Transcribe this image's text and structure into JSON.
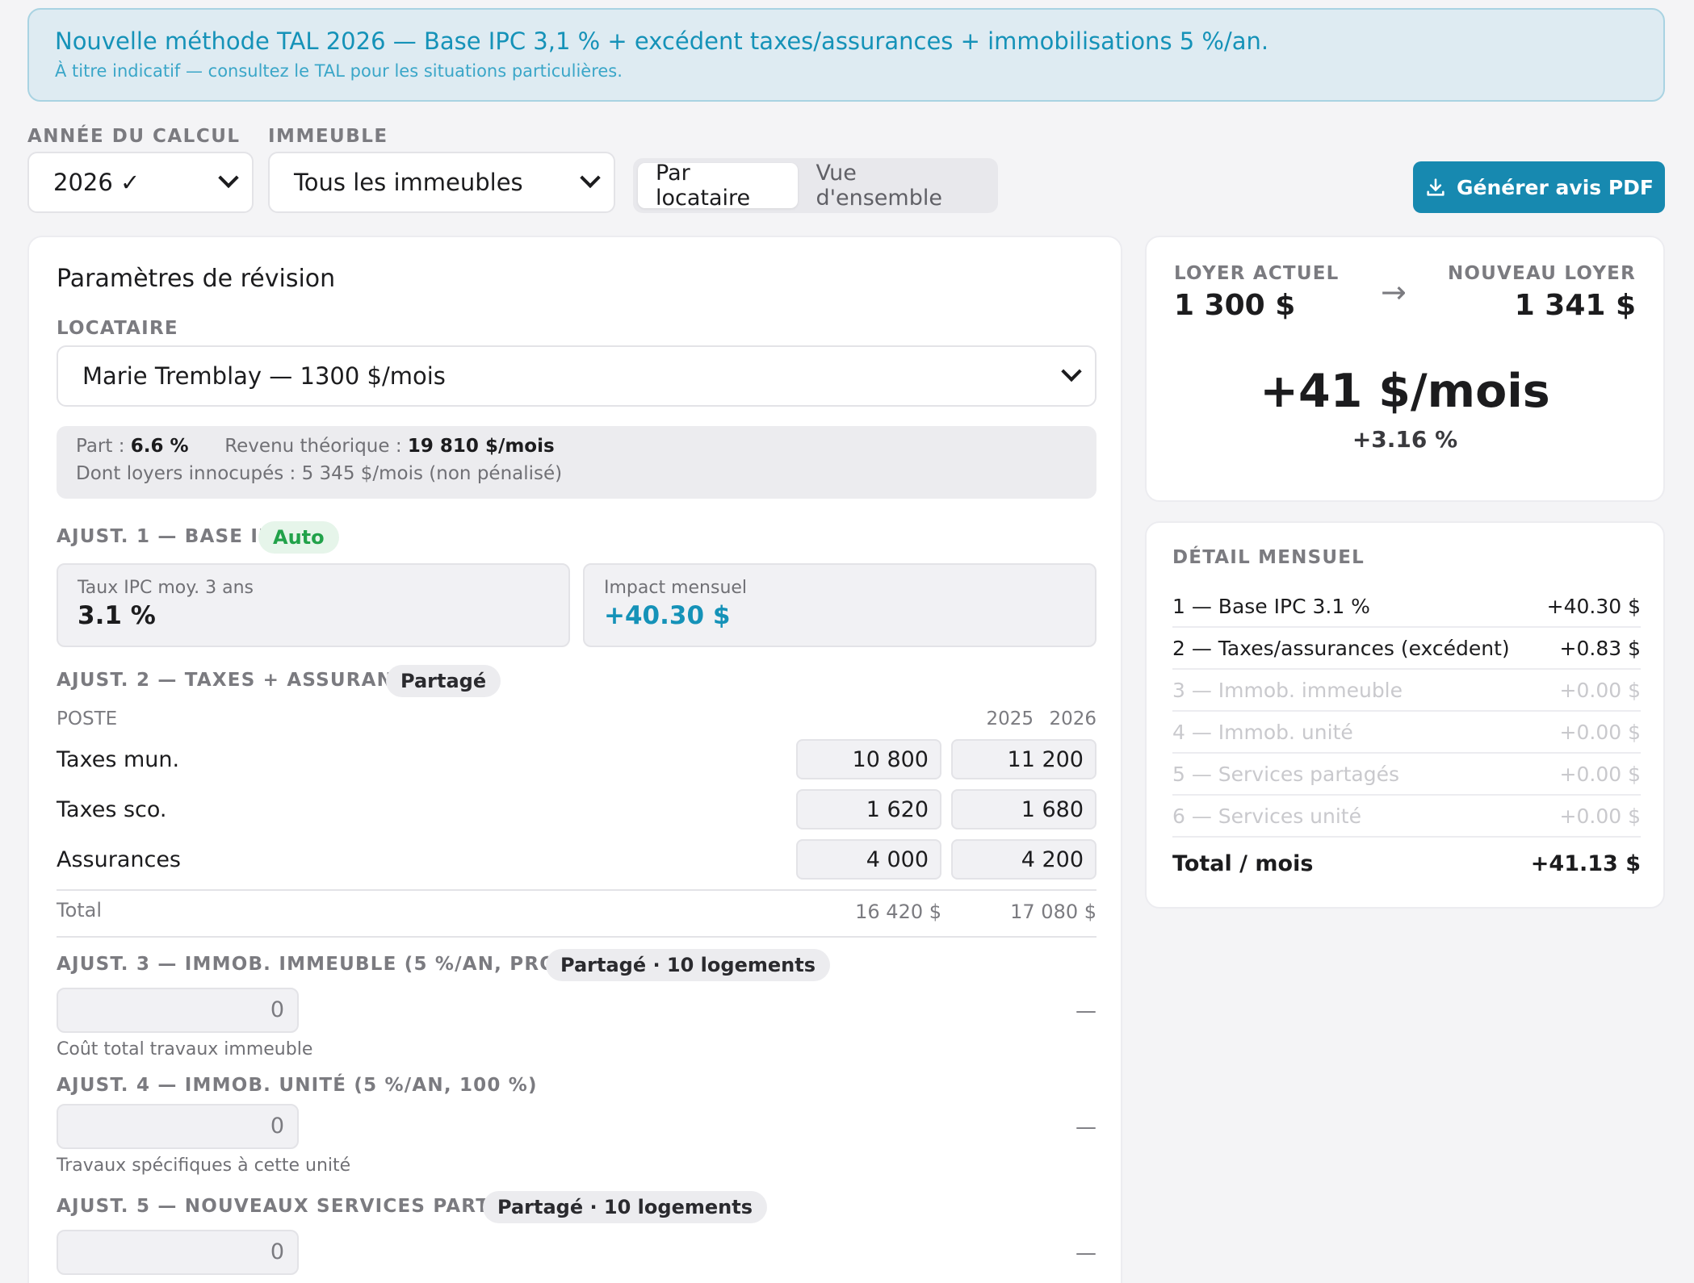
{
  "banner": {
    "title": "Nouvelle méthode TAL 2026 — Base IPC 3,1 % + excédent taxes/assurances + immobilisations 5 %/an.",
    "subtitle": "À titre indicatif — consultez le TAL pour les situations particulières."
  },
  "filters": {
    "year_label": "ANNÉE DU CALCUL",
    "year_value": "2026 ✓",
    "building_label": "IMMEUBLE",
    "building_value": "Tous les immeubles",
    "view_tabs": [
      "Par locataire",
      "Vue d'ensemble"
    ],
    "active_tab": "Par locataire",
    "pdf_button": "Générer avis PDF"
  },
  "params": {
    "title": "Paramètres de révision",
    "tenant_label": "LOCATAIRE",
    "tenant_value": "Marie Tremblay — 1300 $/mois",
    "share_label": "Part :",
    "share_value": "6.6 %",
    "revenue_label": "Revenu théorique :",
    "revenue_value": "19 810 $/mois",
    "vacant_note": "Dont loyers innocupés : 5 345 $/mois (non pénalisé)"
  },
  "adj1": {
    "label": "AJUST. 1 — BASE IPC",
    "badge": "Auto",
    "rate_label": "Taux IPC moy. 3 ans",
    "rate_value": "3.1 %",
    "impact_label": "Impact mensuel",
    "impact_value": "+40.30 $"
  },
  "adj2": {
    "label": "AJUST. 2 — TAXES + ASSURANCES",
    "badge": "Partagé",
    "col_poste": "POSTE",
    "col_2025": "2025",
    "col_2026": "2026",
    "rows": [
      {
        "label": "Taxes mun.",
        "y2025": "10 800",
        "y2026": "11 200"
      },
      {
        "label": "Taxes sco.",
        "y2025": "1 620",
        "y2026": "1 680"
      },
      {
        "label": "Assurances",
        "y2025": "4 000",
        "y2026": "4 200"
      }
    ],
    "total_label": "Total",
    "total_2025": "16 420 $",
    "total_2026": "17 080 $"
  },
  "adj3": {
    "label": "AJUST. 3 — IMMOB. IMMEUBLE (5 %/AN, PRORATÉ)",
    "badge": "Partagé · 10 logements",
    "value": "0",
    "hint": "Coût total travaux immeuble",
    "result": "—"
  },
  "adj4": {
    "label": "AJUST. 4 — IMMOB. UNITÉ (5 %/AN, 100 %)",
    "value": "0",
    "hint": "Travaux spécifiques à cette unité",
    "result": "—"
  },
  "adj5": {
    "label": "AJUST. 5 — NOUVEAUX SERVICES PARTAGÉS",
    "badge": "Partagé · 10 logements",
    "value": "0",
    "result": "—"
  },
  "summary": {
    "current_label": "LOYER ACTUEL",
    "current_value": "1 300 $",
    "arrow": "→",
    "new_label": "NOUVEAU LOYER",
    "new_value": "1 341 $",
    "increase": "+41 $/mois",
    "increase_pct": "+3.16 %"
  },
  "detail": {
    "title": "DÉTAIL MENSUEL",
    "rows": [
      {
        "label": "1 — Base IPC 3.1 %",
        "value": "+40.30 $"
      },
      {
        "label": "2 — Taxes/assurances (excédent)",
        "value": "+0.83 $"
      },
      {
        "label": "3 — Immob. immeuble",
        "value": "+0.00 $"
      },
      {
        "label": "4 — Immob. unité",
        "value": "+0.00 $"
      },
      {
        "label": "5 — Services partagés",
        "value": "+0.00 $"
      },
      {
        "label": "6 — Services unité",
        "value": "+0.00 $"
      }
    ],
    "total_label": "Total / mois",
    "total_value": "+41.13 $"
  },
  "colors": {
    "accent": "#1789b0",
    "banner_bg": "#deebf2",
    "positive_green": "#22a24a",
    "impact_blue": "#1592b8"
  }
}
